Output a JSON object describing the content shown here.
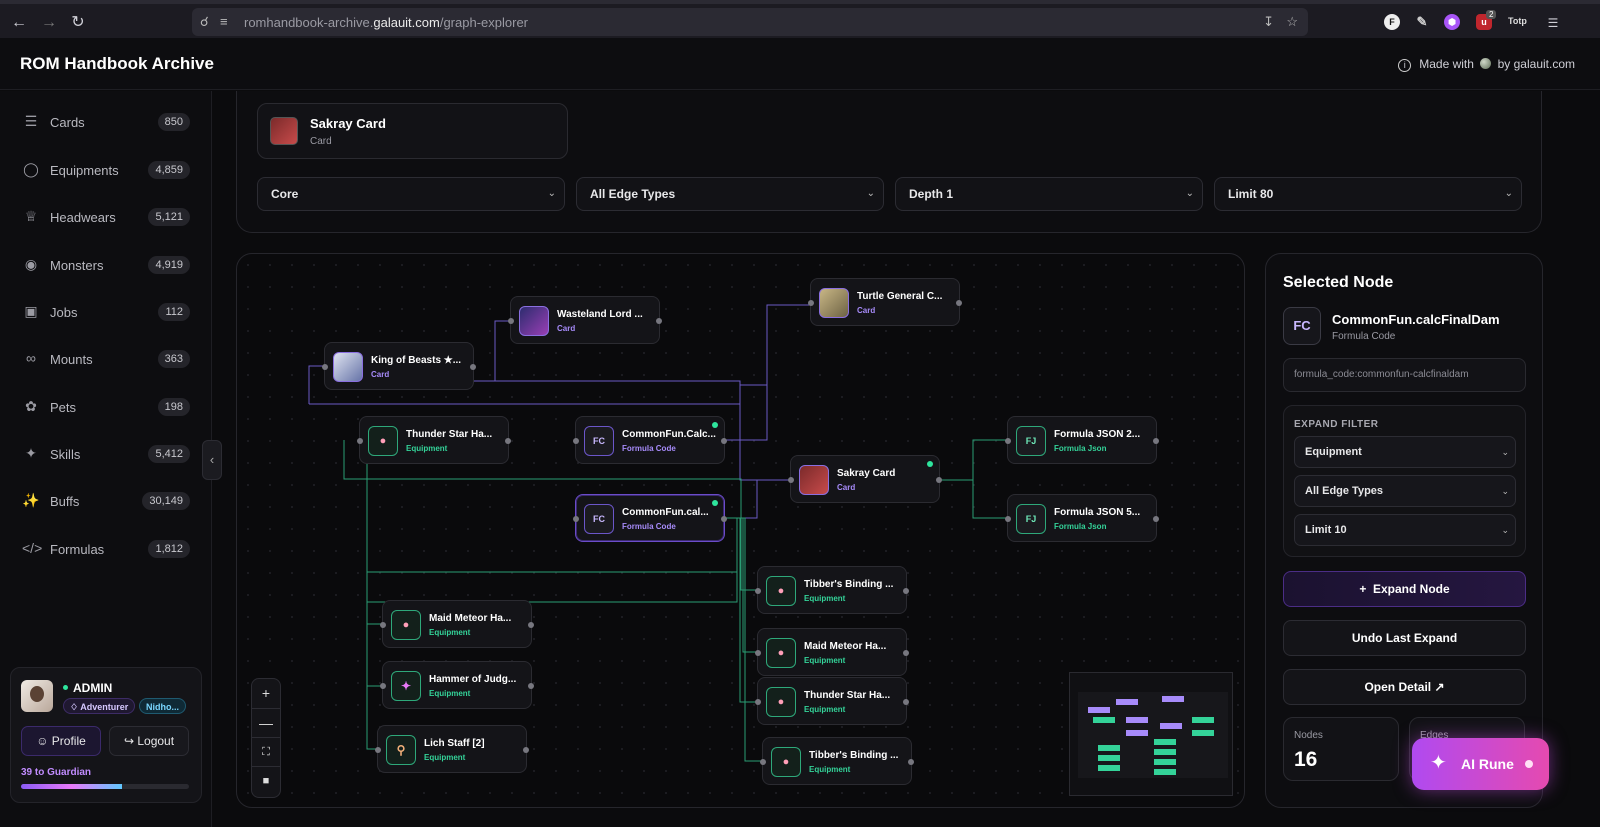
{
  "browser": {
    "url_prefix": "romhandbook-archive.",
    "url_domain": "galauit.com",
    "url_path": "/graph-explorer",
    "ext_f": "F",
    "ext_badge_count": "2",
    "ext_profile": "Totp"
  },
  "header": {
    "brand": "ROM Handbook Archive",
    "made_with": "Made with",
    "by": "by galauit.com"
  },
  "sidebar": {
    "items": [
      {
        "label": "Cards",
        "count": "850",
        "icon": "layers-icon"
      },
      {
        "label": "Equipments",
        "count": "4,859",
        "icon": "shield-icon"
      },
      {
        "label": "Headwears",
        "count": "5,121",
        "icon": "crown-icon"
      },
      {
        "label": "Monsters",
        "count": "4,919",
        "icon": "monster-icon"
      },
      {
        "label": "Jobs",
        "count": "112",
        "icon": "briefcase-icon"
      },
      {
        "label": "Mounts",
        "count": "363",
        "icon": "bike-icon"
      },
      {
        "label": "Pets",
        "count": "198",
        "icon": "paw-icon"
      },
      {
        "label": "Skills",
        "count": "5,412",
        "icon": "sparkles-icon"
      },
      {
        "label": "Buffs",
        "count": "30,149",
        "icon": "wand-icon"
      },
      {
        "label": "Formulas",
        "count": "1,812",
        "icon": "code-icon"
      }
    ]
  },
  "user": {
    "name": "ADMIN",
    "role": "Adventurer",
    "server": "Nidho...",
    "profile_label": "Profile",
    "logout_label": "Logout",
    "progress_label": "39 to Guardian",
    "progress_fraction": 0.6
  },
  "filters": {
    "selected_title": "Sakray Card",
    "selected_type": "Card",
    "view": "Core",
    "edge_types": "All Edge Types",
    "depth": "Depth 1",
    "limit": "Limit 80"
  },
  "graph": {
    "nodes": [
      {
        "title": "Wasteland Lord ...",
        "type": "Card"
      },
      {
        "title": "Turtle General C...",
        "type": "Card"
      },
      {
        "title": "King of Beasts ★...",
        "type": "Card"
      },
      {
        "title": "Thunder Star Ha...",
        "type": "Equipment"
      },
      {
        "title": "CommonFun.Calc...",
        "type": "Formula Code",
        "icon": "FC"
      },
      {
        "title": "Sakray Card",
        "type": "Card"
      },
      {
        "title": "Formula JSON 2...",
        "type": "Formula Json",
        "icon": "FJ"
      },
      {
        "title": "CommonFun.cal...",
        "type": "Formula Code",
        "icon": "FC"
      },
      {
        "title": "Formula JSON 5...",
        "type": "Formula Json",
        "icon": "FJ"
      },
      {
        "title": "Tibber's Binding ...",
        "type": "Equipment"
      },
      {
        "title": "Maid Meteor Ha...",
        "type": "Equipment"
      },
      {
        "title": "Maid Meteor Ha...",
        "type": "Equipment"
      },
      {
        "title": "Hammer of Judg...",
        "type": "Equipment"
      },
      {
        "title": "Thunder Star Ha...",
        "type": "Equipment"
      },
      {
        "title": "Lich Staff [2]",
        "type": "Equipment"
      },
      {
        "title": "Tibber's Binding ...",
        "type": "Equipment"
      }
    ],
    "colors": {
      "card_edge": "#7c6bd6",
      "equip_edge": "#2ea87a"
    }
  },
  "selected_node": {
    "heading": "Selected Node",
    "icon": "FC",
    "name": "CommonFun.calcFinalDam",
    "type": "Formula Code",
    "code": "formula_code:commonfun-calcfinaldam",
    "expand_filter_title": "EXPAND FILTER",
    "expand_type": "Equipment",
    "expand_edges": "All Edge Types",
    "expand_limit": "Limit 10",
    "expand_button": "Expand Node",
    "undo_button": "Undo Last Expand",
    "detail_button": "Open Detail",
    "nodes_label": "Nodes",
    "nodes_value": "16",
    "edges_label": "Edges"
  },
  "ai": {
    "label": "AI Rune"
  }
}
